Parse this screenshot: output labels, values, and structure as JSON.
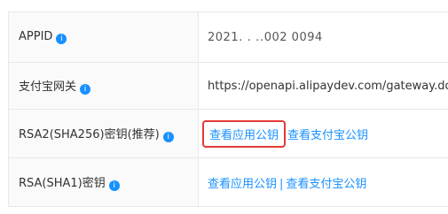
{
  "rows": [
    {
      "label": "APPID",
      "value": "2021․ ․ ․․002 0094"
    },
    {
      "label": "支付宝网关",
      "value": "https://openapi.alipaydev.com/gateway.do"
    },
    {
      "label": "RSA2(SHA256)密钥(推荐)",
      "links": [
        "查看应用公钥",
        "查看支付宝公钥"
      ]
    },
    {
      "label": "RSA(SHA1)密钥",
      "links": [
        "查看应用公钥",
        "查看支付宝公钥"
      ],
      "separator": "|"
    }
  ],
  "info_icon_glyph": "i",
  "colors": {
    "link": "#1890ff",
    "highlight": "#e53935"
  }
}
